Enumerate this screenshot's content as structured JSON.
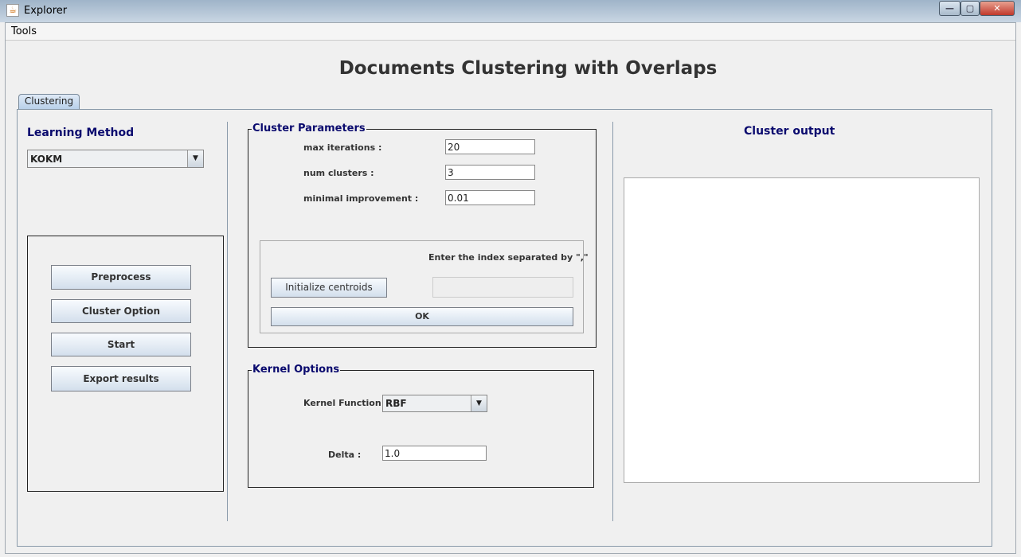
{
  "window": {
    "title": "Explorer",
    "minimize": "—",
    "maximize": "▢",
    "close": "✕"
  },
  "menu": {
    "tools": "Tools"
  },
  "heading": "Documents Clustering with Overlaps",
  "tabs": [
    {
      "label": "Clustering"
    }
  ],
  "left": {
    "title": "Learning Method",
    "method": "KOKM",
    "buttons": [
      "Preprocess",
      "Cluster Option",
      "Start",
      "Export results"
    ]
  },
  "params": {
    "title": "Cluster Parameters",
    "max_iterations_label": "max iterations :",
    "max_iterations": "20",
    "num_clusters_label": "num clusters :",
    "num_clusters": "3",
    "min_improvement_label": "minimal improvement :",
    "min_improvement": "0.01",
    "index_hint": "Enter the index separated by \",\"",
    "init_button": "Initialize centroids",
    "index_value": "",
    "ok_button": "OK"
  },
  "kernel": {
    "title": "Kernel Options",
    "function_label": "Kernel Function",
    "function": "RBF",
    "delta_label": "Delta :",
    "delta": "1.0"
  },
  "output": {
    "title": "Cluster output",
    "text": ""
  }
}
